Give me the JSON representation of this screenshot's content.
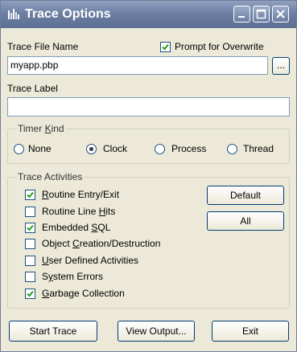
{
  "window": {
    "title": "Trace Options",
    "controls": {
      "minimize": "minimize",
      "maximize": "maximize",
      "close": "close"
    }
  },
  "trace_file": {
    "label": "Trace File Name",
    "value": "myapp.pbp",
    "browse_label": "...",
    "prompt_overwrite": {
      "label": "Prompt for Overwrite",
      "checked": true
    }
  },
  "trace_label": {
    "label": "Trace Label",
    "value": ""
  },
  "timer_kind": {
    "title_pre": "Timer ",
    "title_hot": "K",
    "title_post": "ind",
    "options": [
      {
        "label": "None",
        "selected": false
      },
      {
        "label": "Clock",
        "selected": true
      },
      {
        "label": "Process",
        "selected": false
      },
      {
        "label": "Thread",
        "selected": false
      }
    ]
  },
  "trace_activities": {
    "title": "Trace Activities",
    "items": [
      {
        "pre": "",
        "hot": "R",
        "post": "outine Entry/Exit",
        "checked": true
      },
      {
        "pre": "Routine Line ",
        "hot": "H",
        "post": "its",
        "checked": false
      },
      {
        "pre": "Embedded ",
        "hot": "S",
        "post": "QL",
        "checked": true
      },
      {
        "pre": "Object ",
        "hot": "C",
        "post": "reation/Destruction",
        "checked": false
      },
      {
        "pre": "",
        "hot": "U",
        "post": "ser Defined Activities",
        "checked": false
      },
      {
        "pre": "S",
        "hot": "y",
        "post": "stem Errors",
        "checked": false
      },
      {
        "pre": "",
        "hot": "G",
        "post": "arbage Collection",
        "checked": true
      }
    ],
    "default_label": "Default",
    "all_label": "All"
  },
  "buttons": {
    "start_trace": "Start Trace",
    "view_output": "View Output...",
    "exit": "Exit"
  },
  "colors": {
    "titlebar": "#6c7fa3",
    "check": "#21a121"
  }
}
